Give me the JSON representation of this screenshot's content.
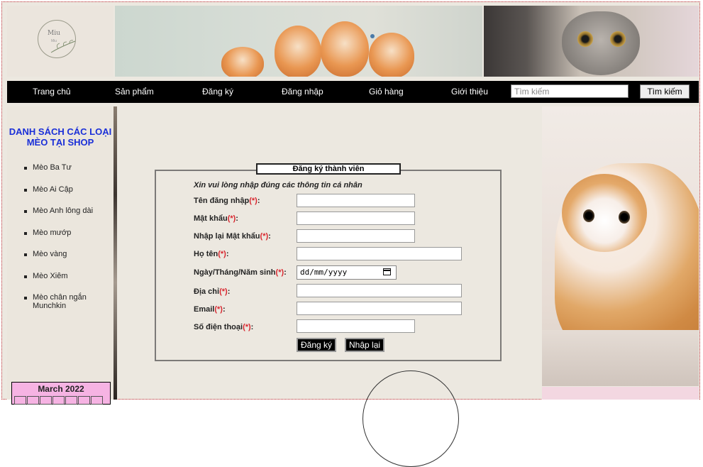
{
  "header": {
    "logo_text": "Miu",
    "logo_sub": "Miu"
  },
  "nav": {
    "items": [
      "Trang chủ",
      "Sản phẩm",
      "Đăng ký",
      "Đăng nhập",
      "Giỏ hàng",
      "Giới thiệu"
    ],
    "search_placeholder": "Tìm kiếm",
    "search_button": "Tìm kiếm"
  },
  "sidebar": {
    "title": "DANH SÁCH CÁC LOẠI MÈO TẠI SHOP",
    "items": [
      "Mèo Ba Tư",
      "Mèo Ai Cập",
      "Mèo Anh lông dài",
      "Mèo mướp",
      "Mèo vàng",
      "Mèo Xiêm",
      "Mèo chân ngắn Munchkin"
    ],
    "calendar_title": "March 2022"
  },
  "form": {
    "legend": "Đăng ký thành viên",
    "intro": "Xin vui lòng nhập đúng các thông tin cá nhân",
    "required_mark": "(*)",
    "fields": [
      {
        "label": "Tên đăng nhập",
        "suffix": ":"
      },
      {
        "label": "Mật khẩu",
        "suffix": ":"
      },
      {
        "label": "Nhập lại Mật khẩu",
        "suffix": ":"
      },
      {
        "label": "Họ tên",
        "suffix": ":"
      },
      {
        "label": "Ngày/Tháng/Năm sinh",
        "suffix": ":"
      },
      {
        "label": "Địa chỉ",
        "suffix": ":"
      },
      {
        "label": "Email",
        "suffix": ":"
      },
      {
        "label": "Số điện thoại",
        "suffix": ":"
      }
    ],
    "date_placeholder": "dd/mm/yyyy",
    "submit_label": "Đăng ký",
    "reset_label": "Nhập lại"
  },
  "colors": {
    "accent_blue": "#1a2fd8",
    "required_red": "#d8262e",
    "nav_bg": "#000000",
    "calendar_pink": "#f6b3e3",
    "page_bg": "#ece8e0"
  }
}
